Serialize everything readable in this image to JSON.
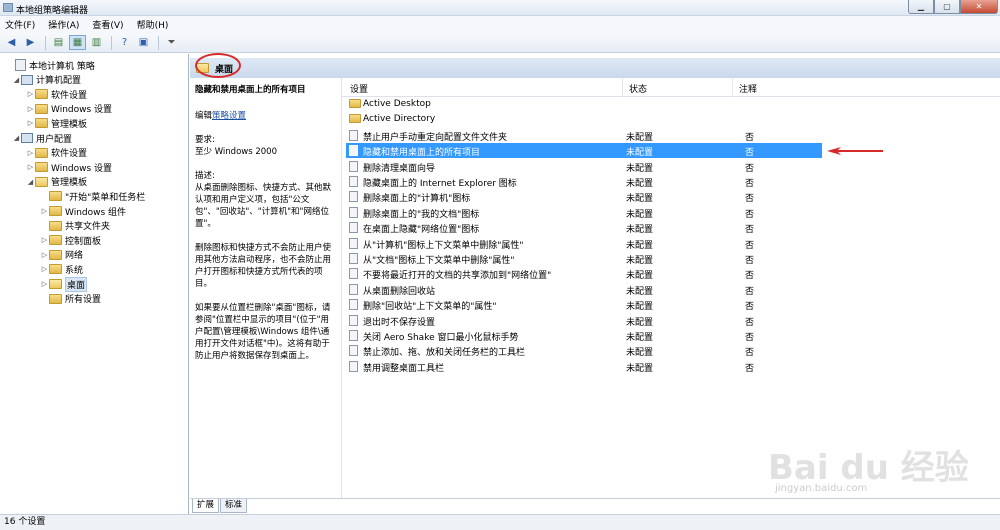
{
  "window": {
    "title": "本地组策略编辑器"
  },
  "menu": [
    "文件(F)",
    "操作(A)",
    "查看(V)",
    "帮助(H)"
  ],
  "tree": [
    {
      "label": "本地计算机 策略",
      "depth": 0,
      "icon": "policy-icon",
      "arrow": ""
    },
    {
      "label": "计算机配置",
      "depth": 1,
      "icon": "computer-icon",
      "arrow": "◢"
    },
    {
      "label": "软件设置",
      "depth": 2,
      "icon": "folder-icon",
      "arrow": "▷"
    },
    {
      "label": "Windows 设置",
      "depth": 2,
      "icon": "folder-icon",
      "arrow": "▷"
    },
    {
      "label": "管理模板",
      "depth": 2,
      "icon": "folder-icon",
      "arrow": "▷"
    },
    {
      "label": "用户配置",
      "depth": 1,
      "icon": "computer-icon",
      "arrow": "◢"
    },
    {
      "label": "软件设置",
      "depth": 2,
      "icon": "folder-icon",
      "arrow": "▷"
    },
    {
      "label": "Windows 设置",
      "depth": 2,
      "icon": "folder-icon",
      "arrow": "▷"
    },
    {
      "label": "管理模板",
      "depth": 2,
      "icon": "folder-open-icon",
      "arrow": "◢"
    },
    {
      "label": "\"开始\"菜单和任务栏",
      "depth": 3,
      "icon": "folder-icon",
      "arrow": ""
    },
    {
      "label": "Windows 组件",
      "depth": 3,
      "icon": "folder-icon",
      "arrow": "▷"
    },
    {
      "label": "共享文件夹",
      "depth": 3,
      "icon": "folder-icon",
      "arrow": ""
    },
    {
      "label": "控制面板",
      "depth": 3,
      "icon": "folder-icon",
      "arrow": "▷"
    },
    {
      "label": "网络",
      "depth": 3,
      "icon": "folder-icon",
      "arrow": "▷"
    },
    {
      "label": "系统",
      "depth": 3,
      "icon": "folder-icon",
      "arrow": "▷"
    },
    {
      "label": "桌面",
      "depth": 3,
      "icon": "folder-open-icon",
      "arrow": "▷",
      "selected": true
    },
    {
      "label": "所有设置",
      "depth": 3,
      "icon": "folder-icon",
      "arrow": ""
    }
  ],
  "header": {
    "label": "桌面"
  },
  "description": {
    "title": "隐藏和禁用桌面上的所有项目",
    "edit_prefix": "编辑",
    "edit_link": "策略设置",
    "req_label": "要求:",
    "req_value": "至少 Windows 2000",
    "desc_label": "描述:",
    "p1": "从桌面删除图标、快捷方式、其他默认项和用户定义项，包括\"公文包\"、\"回收站\"、\"计算机\"和\"网络位置\"。",
    "p2": "删除图标和快捷方式不会防止用户使用其他方法启动程序，也不会防止用户打开图标和快捷方式所代表的项目。",
    "p3": "如果要从位置栏删除\"桌面\"图标，请参阅\"位置栏中显示的项目\"(位于\"用户配置\\管理模板\\Windows 组件\\通用打开文件对话框\"中)。这将有助于防止用户将数据保存到桌面上。"
  },
  "columns": {
    "setting": "设置",
    "state": "状态",
    "comment": "注释"
  },
  "rows": [
    {
      "name": "Active Desktop",
      "state": "",
      "comment": "",
      "type": "folder"
    },
    {
      "name": "Active Directory",
      "state": "",
      "comment": "",
      "type": "folder"
    },
    {
      "name": "禁止用户手动重定向配置文件文件夹",
      "state": "未配置",
      "comment": "否",
      "type": "policy"
    },
    {
      "name": "隐藏和禁用桌面上的所有项目",
      "state": "未配置",
      "comment": "否",
      "type": "policy",
      "selected": true
    },
    {
      "name": "删除清理桌面向导",
      "state": "未配置",
      "comment": "否",
      "type": "policy"
    },
    {
      "name": "隐藏桌面上的 Internet Explorer 图标",
      "state": "未配置",
      "comment": "否",
      "type": "policy"
    },
    {
      "name": "删除桌面上的\"计算机\"图标",
      "state": "未配置",
      "comment": "否",
      "type": "policy"
    },
    {
      "name": "删除桌面上的\"我的文档\"图标",
      "state": "未配置",
      "comment": "否",
      "type": "policy"
    },
    {
      "name": "在桌面上隐藏\"网络位置\"图标",
      "state": "未配置",
      "comment": "否",
      "type": "policy"
    },
    {
      "name": "从\"计算机\"图标上下文菜单中删除\"属性\"",
      "state": "未配置",
      "comment": "否",
      "type": "policy"
    },
    {
      "name": "从\"文档\"图标上下文菜单中删除\"属性\"",
      "state": "未配置",
      "comment": "否",
      "type": "policy"
    },
    {
      "name": "不要将最近打开的文档的共享添加到\"网络位置\"",
      "state": "未配置",
      "comment": "否",
      "type": "policy"
    },
    {
      "name": "从桌面删除回收站",
      "state": "未配置",
      "comment": "否",
      "type": "policy"
    },
    {
      "name": "删除\"回收站\"上下文菜单的\"属性\"",
      "state": "未配置",
      "comment": "否",
      "type": "policy"
    },
    {
      "name": "退出时不保存设置",
      "state": "未配置",
      "comment": "否",
      "type": "policy"
    },
    {
      "name": "关闭 Aero Shake 窗口最小化鼠标手势",
      "state": "未配置",
      "comment": "否",
      "type": "policy"
    },
    {
      "name": "禁止添加、拖、放和关闭任务栏的工具栏",
      "state": "未配置",
      "comment": "否",
      "type": "policy"
    },
    {
      "name": "禁用调整桌面工具栏",
      "state": "未配置",
      "comment": "否",
      "type": "policy"
    }
  ],
  "tabs": [
    "扩展",
    "标准"
  ],
  "status": "16 个设置",
  "watermark": {
    "brand": "Bai du 经验",
    "url": "jingyan.baidu.com"
  },
  "colors": {
    "selection": "#3399ff",
    "annotation": "#d62a2a"
  }
}
